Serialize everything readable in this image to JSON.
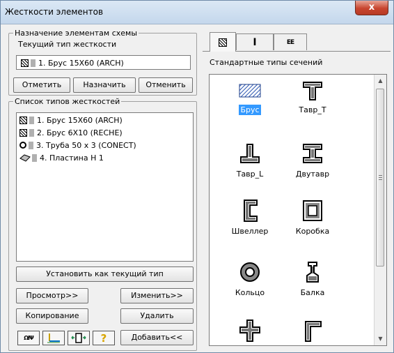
{
  "window": {
    "title": "Жесткости элементов",
    "close_glyph": "x"
  },
  "assign": {
    "legend_line1": "Назначение элементам схемы",
    "legend_line2": "Текущий тип жесткости",
    "current_type": "1. Брус 15Х60 (ARCH)",
    "buttons": {
      "mark": "Отметить",
      "assign": "Назначить",
      "cancel": "Отменить"
    }
  },
  "types_list": {
    "legend": "Список типов жесткостей",
    "items": [
      {
        "label": "1. Брус 15Х60 (ARCH)",
        "icon": "hatched-square-icon"
      },
      {
        "label": "2. Брус 6Х10 (RECHE)",
        "icon": "hatched-square-icon"
      },
      {
        "label": "3. Труба 50 х 3 (CONECT)",
        "icon": "circle-icon"
      },
      {
        "label": "4. Пластина  Н 1",
        "icon": "plate-icon"
      }
    ]
  },
  "buttons": {
    "set_current": "Установить как текущий тип",
    "view": "Просмотр>>",
    "edit": "Изменить>>",
    "copy": "Копирование",
    "delete": "Удалить",
    "add": "Добавить<<"
  },
  "tabs": [
    {
      "icon": "hatched-section-icon",
      "active": true
    },
    {
      "icon": "i-beam-icon",
      "glyph": "I",
      "active": false
    },
    {
      "icon": "double-section-icon",
      "glyph": "EE",
      "active": false
    }
  ],
  "gallery": {
    "title": "Стандартные типы сечений",
    "items": [
      {
        "label": "Брус",
        "icon": "rect-bar-section-icon",
        "selected": true
      },
      {
        "label": "Тавр_Т",
        "icon": "tee-section-icon"
      },
      {
        "label": "Тавр_L",
        "icon": "inverted-tee-section-icon"
      },
      {
        "label": "Двутавр",
        "icon": "i-beam-section-icon"
      },
      {
        "label": "Швеллер",
        "icon": "channel-section-icon"
      },
      {
        "label": "Коробка",
        "icon": "box-section-icon"
      },
      {
        "label": "Кольцо",
        "icon": "ring-section-icon"
      },
      {
        "label": "Балка",
        "icon": "beam-section-icon"
      },
      {
        "label": "",
        "icon": "cross-section-icon"
      },
      {
        "label": "",
        "icon": "angle-section-icon"
      }
    ]
  },
  "toolbar": [
    {
      "icon": "db-tools-icon",
      "glyph": "ΩΙΨ"
    },
    {
      "icon": "axes-icon"
    },
    {
      "icon": "section-orient-icon"
    },
    {
      "icon": "help-icon",
      "glyph": "?"
    }
  ],
  "colors": {
    "selection": "#3399ff",
    "close": "#c8452f",
    "help": "#d8a500"
  }
}
